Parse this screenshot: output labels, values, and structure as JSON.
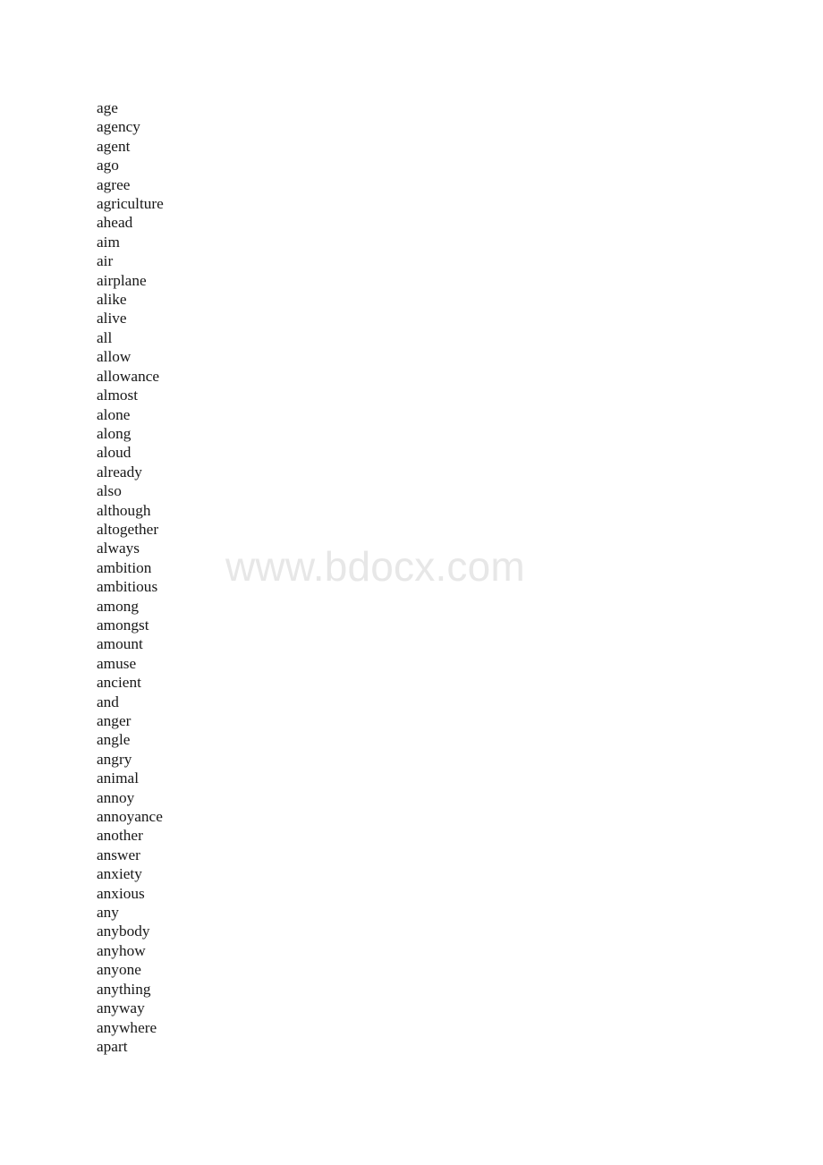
{
  "document": {
    "page_background": "#ffffff",
    "text_color": "#181818",
    "watermark_color": "#e7e7e7"
  },
  "watermark": {
    "text": "www.bdocx.com"
  },
  "word_list": {
    "words": [
      "age",
      "agency",
      "agent",
      "ago",
      "agree",
      "agriculture",
      "ahead",
      "aim",
      "air",
      "airplane",
      "alike",
      "alive",
      "all",
      "allow",
      "allowance",
      "almost",
      "alone",
      "along",
      "aloud",
      "already",
      "also",
      "although",
      "altogether",
      "always",
      "ambition",
      "ambitious",
      "among",
      "amongst",
      "amount",
      "amuse",
      "ancient",
      "and",
      "anger",
      "angle",
      "angry",
      "animal",
      "annoy",
      "annoyance",
      "another",
      "answer",
      "anxiety",
      "anxious",
      "any",
      "anybody",
      "anyhow",
      "anyone",
      "anything",
      "anyway",
      "anywhere",
      "apart"
    ]
  }
}
